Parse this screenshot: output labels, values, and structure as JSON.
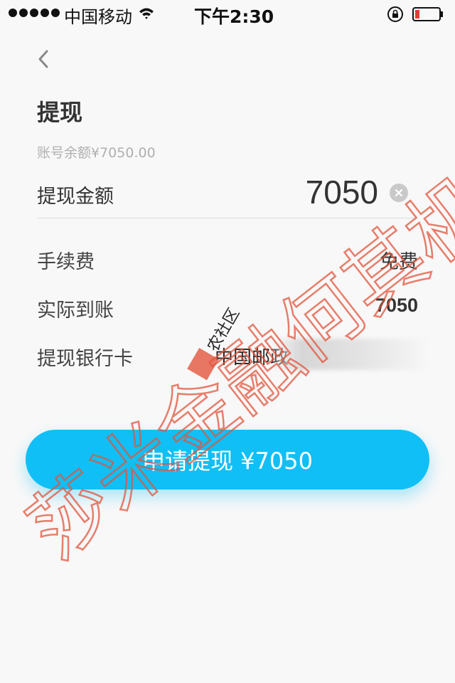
{
  "status_bar": {
    "carrier": "中国移动",
    "time": "下午2:30",
    "signal_icon": "signal-dots-icon",
    "wifi_icon": "wifi-icon",
    "lock_icon": "orientation-lock-icon",
    "battery_icon": "battery-low-icon",
    "battery_color": "#e53935"
  },
  "nav": {
    "back_icon": "chevron-left-icon"
  },
  "page": {
    "title": "提现",
    "balance_text": "账号余额¥7050.00"
  },
  "form": {
    "amount_label": "提现金额",
    "amount_value": "7050",
    "clear_icon": "clear-circle-icon",
    "fee_label": "手续费",
    "fee_value": "免费",
    "actual_label": "实际到账",
    "actual_value": "7050",
    "bank_label": "提现银行卡",
    "bank_value": "中国邮政"
  },
  "submit": {
    "label": "申请提现 ¥7050"
  },
  "watermark": {
    "main_text": "莎米金融何其机",
    "stamp_text": "农社区",
    "color": "#e2553c"
  },
  "colors": {
    "accent": "#10bff5",
    "background": "#f8f8f8",
    "text_primary": "#333333",
    "text_muted": "#b0b0b0"
  }
}
